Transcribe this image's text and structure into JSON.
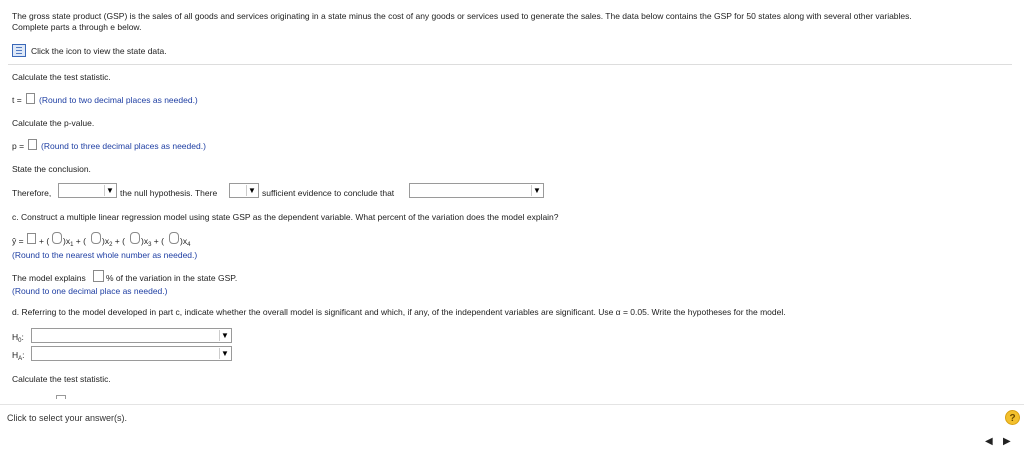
{
  "intro": {
    "line1": "The gross state product (GSP) is the sales of all goods and services originating in a state minus the cost of any goods or services used to generate the sales. The data below contains the GSP for 50 states along with several other variables.",
    "line2": "Complete parts a through e below."
  },
  "data_link": {
    "label": "Click the icon to view the state data.",
    "icon": "table-grid-icon"
  },
  "part_t": {
    "heading": "Calculate the test statistic.",
    "label": "t =",
    "hint": "(Round to two decimal places as needed.)"
  },
  "part_p": {
    "heading": "Calculate the p-value.",
    "label": "p =",
    "hint": "(Round to three decimal places as needed.)"
  },
  "conclusion": {
    "heading": "State the conclusion.",
    "therefore": "Therefore,",
    "mid": "the null hypothesis. There",
    "end": "sufficient evidence to conclude that"
  },
  "part_c": {
    "question": "c. Construct a multiple linear regression model using state GSP as the dependent variable. What percent of the variation does the model explain?",
    "yhat": "ŷ =",
    "hint": "(Round to the nearest whole number as needed.)",
    "explains_pre": "The model explains",
    "explains_post": "% of the variation in the state GSP.",
    "hint2": "(Round to one decimal place as needed.)"
  },
  "part_d": {
    "question": "d. Referring to the model developed in part c, indicate whether the overall model is significant and which, if any, of the independent variables are significant. Use α = 0.05. Write the hypotheses for the model.",
    "h0": "H",
    "h0_sub": "0",
    "ha": "H",
    "ha_sub": "A",
    "test_stat": "Calculate the test statistic."
  },
  "footer": {
    "prompt": "Click to select your answer(s).",
    "help": "?",
    "prev": "◀",
    "next": "▶"
  }
}
